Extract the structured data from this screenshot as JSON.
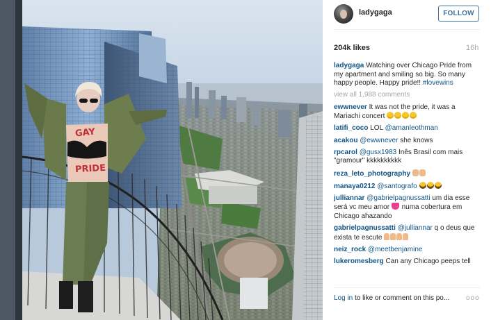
{
  "post": {
    "username": "ladygaga",
    "follow_label": "FOLLOW",
    "likes": "204k likes",
    "time_ago": "16h",
    "caption_user": "ladygaga",
    "caption_text": "Watching over Chicago Pride from my apartment and smiling so big. So many happy people. Happy pride!! ",
    "caption_hashtag": "#lovewins",
    "view_all": "view all 1,988 comments",
    "login_text": "Log in",
    "footer_rest": " to like or comment on this po...",
    "more_label": "ooo"
  },
  "photo": {
    "alt": "Lady Gaga on balcony above Chicago skyline",
    "body_paint_1": "GAY",
    "body_paint_2": "PRIDE"
  },
  "comments": [
    {
      "user": "ewwnever",
      "text": " It was not the pride, it was a Mariachi concert ",
      "emoji": "laugh",
      "emoji_count": 4
    },
    {
      "user": "latifi_coco",
      "text": " LOL ",
      "mention": "@amanleothman"
    },
    {
      "user": "acakou",
      "text": " ",
      "mention": "@ewwnever",
      "text_after": " she knows"
    },
    {
      "user": "rpcarol",
      "text": " ",
      "mention": "@gusx1983",
      "text_after": " Inês Brasil com mais \"gramour\" kkkkkkkkkk"
    },
    {
      "user": "reza_leto_photography",
      "text": " ",
      "emoji": "ok",
      "emoji_count": 2
    },
    {
      "user": "manaya0212",
      "text": " ",
      "mention": "@santografo",
      "emoji": "scream",
      "emoji_count": 3
    },
    {
      "user": "julliannar",
      "text": " ",
      "mention": "@gabrielpagnussatti",
      "text_after": " um dia esse será vc meu amor ",
      "emoji": "heart",
      "emoji_count": 1,
      "text_tail": " numa cobertura em Chicago ahazando"
    },
    {
      "user": "gabrielpagnussatti",
      "text": " ",
      "mention": "@julliannar",
      "text_after": " q o deus que exista te escute ",
      "emoji": "hands",
      "emoji_count": 4
    },
    {
      "user": "neiz_rock",
      "text": " ",
      "mention": "@meetbenjamine"
    },
    {
      "user": "lukeromesberg",
      "text": " Can any Chicago peeps tell"
    }
  ],
  "colors": {
    "link_blue": "#125688",
    "follow_blue": "#3f729b",
    "muted_gray": "#a5a7aa",
    "text": "#262626"
  }
}
